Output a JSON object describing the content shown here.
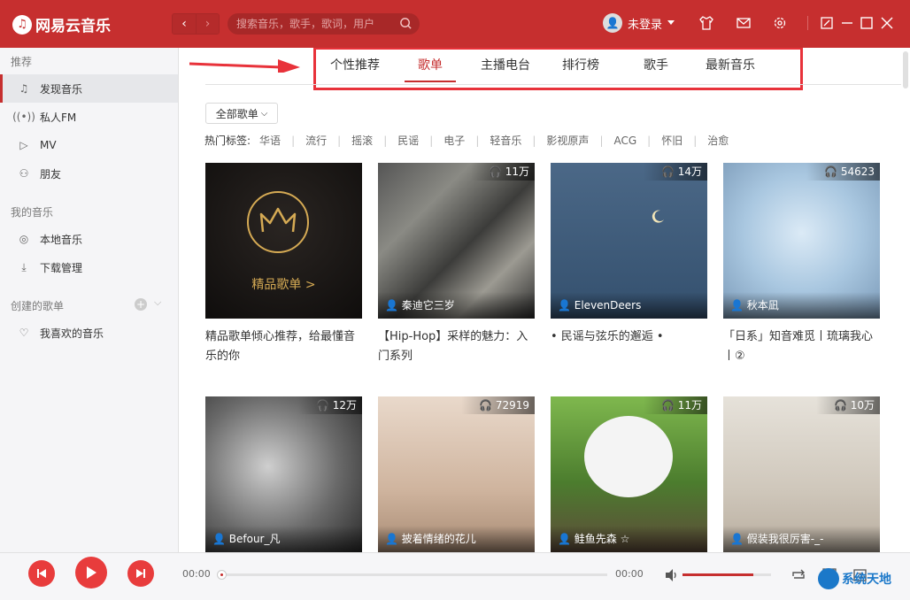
{
  "app": {
    "name": "网易云音乐"
  },
  "header": {
    "search_placeholder": "搜索音乐，歌手，歌词，用户",
    "user_label": "未登录"
  },
  "sidebar": {
    "section_recommend": "推荐",
    "items_recommend": [
      {
        "label": "发现音乐",
        "icon": "music-note-icon"
      },
      {
        "label": "私人FM",
        "icon": "radio-icon"
      },
      {
        "label": "MV",
        "icon": "video-icon"
      },
      {
        "label": "朋友",
        "icon": "friends-icon"
      }
    ],
    "section_my": "我的音乐",
    "items_my": [
      {
        "label": "本地音乐",
        "icon": "disc-icon"
      },
      {
        "label": "下载管理",
        "icon": "download-icon"
      }
    ],
    "section_created": "创建的歌单",
    "items_created": [
      {
        "label": "我喜欢的音乐",
        "icon": "heart-icon"
      }
    ]
  },
  "tabs": [
    "个性推荐",
    "歌单",
    "主播电台",
    "排行榜",
    "歌手",
    "最新音乐"
  ],
  "active_tab": "歌单",
  "filter": {
    "all_button": "全部歌单",
    "hot_label": "热门标签:",
    "tags": [
      "华语",
      "流行",
      "摇滚",
      "民谣",
      "电子",
      "轻音乐",
      "影视原声",
      "ACG",
      "怀旧",
      "治愈"
    ]
  },
  "playlists": [
    {
      "title": "精品歌单倾心推荐，给最懂音乐的你",
      "count": "",
      "creator": "",
      "special_label": "精品歌单 >"
    },
    {
      "title": "【Hip-Hop】采样的魅力：入门系列",
      "count": "11万",
      "creator": "秦迪它三岁"
    },
    {
      "title": "• 民谣与弦乐的邂逅 •",
      "count": "14万",
      "creator": "ElevenDeers"
    },
    {
      "title": "「日系」知音难觅丨琉璃我心丨②",
      "count": "54623",
      "creator": "秋本凪"
    },
    {
      "title": "",
      "count": "12万",
      "creator": "Befour_凡"
    },
    {
      "title": "",
      "count": "72919",
      "creator": "披着情绪的花儿"
    },
    {
      "title": "",
      "count": "11万",
      "creator": "鲑鱼先森 ☆"
    },
    {
      "title": "",
      "count": "10万",
      "creator": "假装我很厉害-_-"
    }
  ],
  "player": {
    "current_time": "00:00",
    "total_time": "00:00",
    "progress": 0,
    "volume": 0.8
  },
  "watermark": {
    "text": "系统天地"
  },
  "colors": {
    "brand": "#c62f2f",
    "highlight_box": "#e8323a"
  }
}
